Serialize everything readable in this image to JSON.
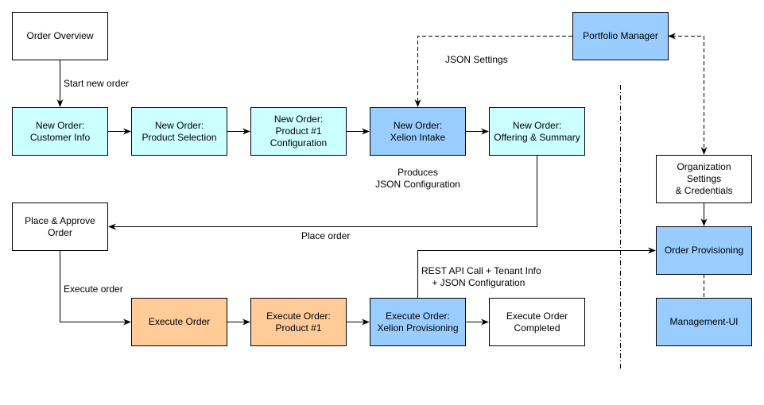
{
  "colors": {
    "white": "#ffffff",
    "cyan": "#ccffff",
    "blue": "#99ccff",
    "orange": "#ffcc99",
    "stroke": "#000000"
  },
  "nodes": {
    "order_overview": {
      "label": "Order Overview",
      "fill": "white"
    },
    "customer_info": {
      "label": "New Order:\nCustomer Info",
      "fill": "cyan"
    },
    "product_selection": {
      "label": "New Order:\nProduct Selection",
      "fill": "cyan"
    },
    "product_config": {
      "label": "New Order:\nProduct #1\nConfiguration",
      "fill": "cyan"
    },
    "xelion_intake": {
      "label": "New Order:\nXelion Intake",
      "fill": "blue"
    },
    "offering_summary": {
      "label": "New Order:\nOffering & Summary",
      "fill": "cyan"
    },
    "portfolio_manager": {
      "label": "Portfolio Manager",
      "fill": "blue"
    },
    "org_settings": {
      "label": "Organization\nSettings\n& Credentials",
      "fill": "white"
    },
    "place_approve": {
      "label": "Place & Approve\nOrder",
      "fill": "white"
    },
    "execute_order": {
      "label": "Execute Order",
      "fill": "orange"
    },
    "execute_product": {
      "label": "Execute Order:\nProduct #1",
      "fill": "orange"
    },
    "execute_xelion": {
      "label": "Execute Order:\nXelion Provisioning",
      "fill": "blue"
    },
    "execute_completed": {
      "label": "Execute Order\nCompleted",
      "fill": "white"
    },
    "order_provisioning": {
      "label": "Order Provisioning",
      "fill": "blue"
    },
    "management_ui": {
      "label": "Management-UI",
      "fill": "blue"
    }
  },
  "edge_labels": {
    "start_new_order": "Start new order",
    "json_settings": "JSON Settings",
    "produces_json": "Produces\nJSON Configuration",
    "place_order": "Place order",
    "execute_order": "Execute order",
    "rest_api": "REST API Call + Tenant Info\n    + JSON Configuration"
  },
  "edges": [
    {
      "from": "order_overview",
      "to": "customer_info",
      "style": "solid"
    },
    {
      "from": "customer_info",
      "to": "product_selection",
      "style": "solid"
    },
    {
      "from": "product_selection",
      "to": "product_config",
      "style": "solid"
    },
    {
      "from": "product_config",
      "to": "xelion_intake",
      "style": "solid"
    },
    {
      "from": "xelion_intake",
      "to": "offering_summary",
      "style": "solid"
    },
    {
      "from": "portfolio_manager",
      "to": "xelion_intake",
      "style": "dashed"
    },
    {
      "from": "org_settings",
      "to": "portfolio_manager",
      "style": "dashed",
      "bidirectional": true
    },
    {
      "from": "offering_summary",
      "to": "place_approve",
      "style": "solid"
    },
    {
      "from": "place_approve",
      "to": "execute_order",
      "style": "solid"
    },
    {
      "from": "execute_order",
      "to": "execute_product",
      "style": "solid"
    },
    {
      "from": "execute_product",
      "to": "execute_xelion",
      "style": "solid"
    },
    {
      "from": "execute_xelion",
      "to": "execute_completed",
      "style": "solid"
    },
    {
      "from": "execute_xelion",
      "to": "order_provisioning",
      "style": "solid"
    },
    {
      "from": "org_settings",
      "to": "order_provisioning",
      "style": "solid"
    },
    {
      "from": "order_provisioning",
      "to": "management_ui",
      "style": "dashed",
      "arrow": false
    }
  ]
}
